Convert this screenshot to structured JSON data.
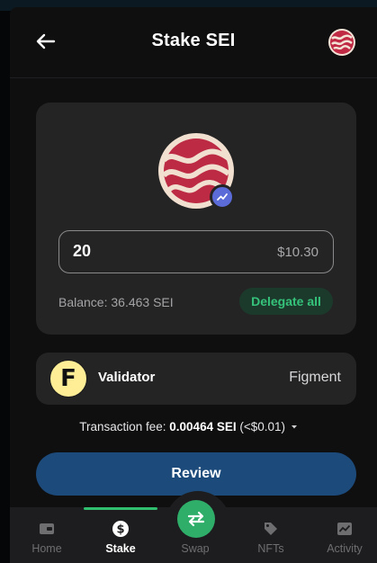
{
  "header": {
    "title": "Stake SEI",
    "back_icon": "arrow-left-icon",
    "logo": "sei-logo"
  },
  "stake": {
    "amount": "20",
    "amount_usd": "$10.30",
    "balance": "Balance: 36.463 SEI",
    "delegate_all_label": "Delegate all"
  },
  "validator": {
    "logo_letter": "F",
    "label": "Validator",
    "name": "Figment"
  },
  "fee": {
    "prefix": "Transaction fee:",
    "amount": "0.00464 SEI",
    "usd": "(<$0.01)"
  },
  "review_label": "Review",
  "nav": {
    "items": [
      {
        "label": "Home",
        "icon": "wallet-icon"
      },
      {
        "label": "Stake",
        "icon": "dollar-icon"
      },
      {
        "label": "Swap",
        "icon": "swap-arrows-icon"
      },
      {
        "label": "NFTs",
        "icon": "tag-icon"
      },
      {
        "label": "Activity",
        "icon": "activity-chart-icon"
      }
    ],
    "active": "Stake"
  },
  "colors": {
    "accent_green": "#2fae6a",
    "review_blue": "#1c4a7a",
    "card_bg": "#242425",
    "sei_red": "#b8283f"
  }
}
